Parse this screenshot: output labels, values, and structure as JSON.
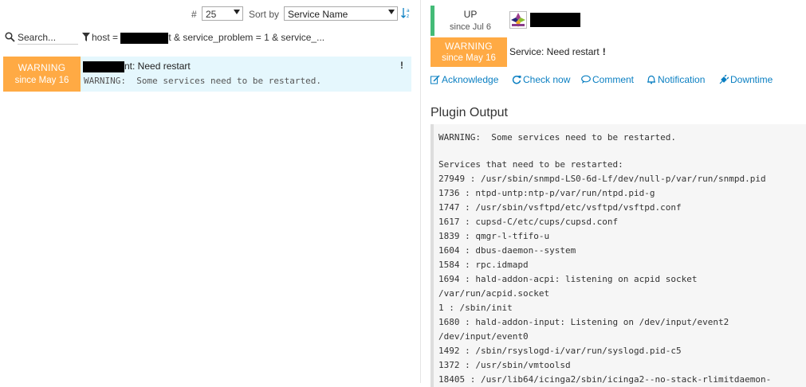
{
  "controls": {
    "limit_label": "#",
    "limit_value": "25",
    "sort_label": "Sort by",
    "sort_value": "Service Name"
  },
  "search": {
    "placeholder": "Search...",
    "filter_prefix": "host = ",
    "filter_suffix": "t & service_problem = 1 & service_..."
  },
  "list": {
    "item": {
      "state": "WARNING",
      "since": "since May 16",
      "title_suffix": "nt: Need restart",
      "flag": "!",
      "output": "WARNING:  Some services need to be restarted."
    }
  },
  "detail": {
    "host": {
      "state": "UP",
      "since": "since Jul 6",
      "os_icon": "centos-logo"
    },
    "service": {
      "state": "WARNING",
      "since": "since May 16",
      "title": "Service: Need restart",
      "flag": "!"
    },
    "actions": [
      {
        "label": "Acknowledge",
        "icon": "edit-icon"
      },
      {
        "label": "Check now",
        "icon": "refresh-icon"
      },
      {
        "label": "Comment",
        "icon": "comment-icon"
      },
      {
        "label": "Notification",
        "icon": "bell-icon"
      },
      {
        "label": "Downtime",
        "icon": "plug-icon"
      }
    ],
    "plugin_output_title": "Plugin Output",
    "plugin_output_lines": [
      "WARNING:  Some services need to be restarted.",
      "",
      "Services that need to be restarted:",
      "27949 : /usr/sbin/snmpd-LS0-6d-Lf/dev/null-p/var/run/snmpd.pid",
      "1736 : ntpd-untp:ntp-p/var/run/ntpd.pid-g",
      "1747 : /usr/sbin/vsftpd/etc/vsftpd/vsftpd.conf",
      "1617 : cupsd-C/etc/cups/cupsd.conf",
      "1839 : qmgr-l-tfifo-u",
      "1604 : dbus-daemon--system",
      "1584 : rpc.idmapd",
      "1694 : hald-addon-acpi: listening on acpid socket",
      "/var/run/acpid.socket",
      "1 : /sbin/init",
      "1680 : hald-addon-input: Listening on /dev/input/event2",
      "/dev/input/event0",
      "1492 : /sbin/rsyslogd-i/var/run/syslogd.pid-c5",
      "1372 : /usr/sbin/vmtoolsd",
      "18405 : /usr/lib64/icinga2/sbin/icinga2--no-stack-rlimitdaemon-"
    ]
  }
}
